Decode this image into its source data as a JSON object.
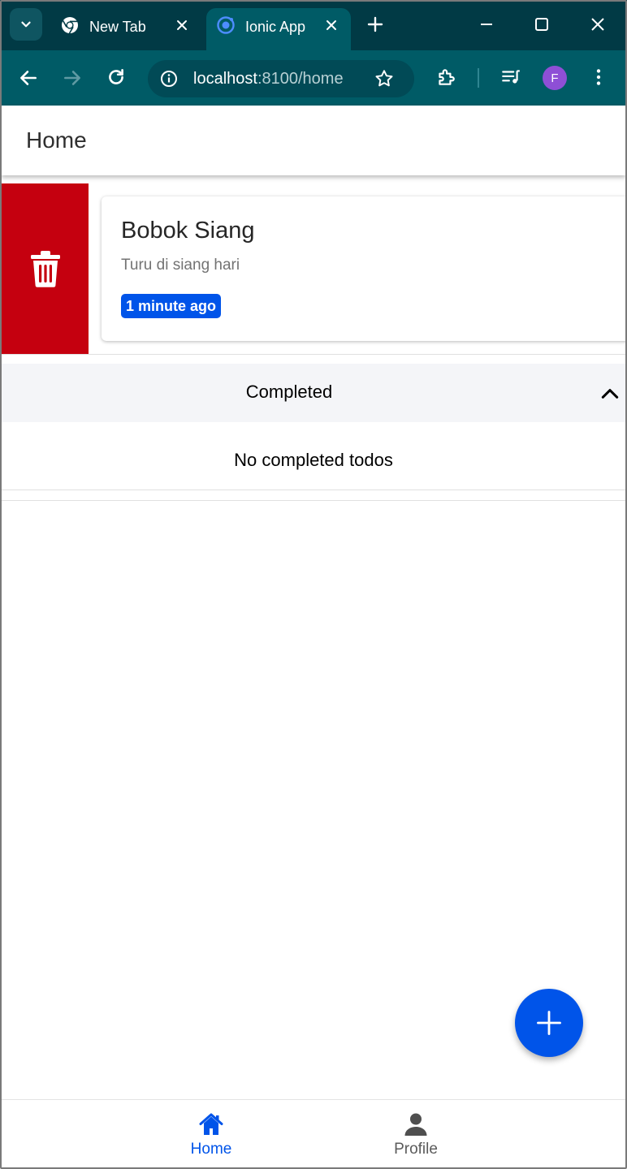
{
  "browser": {
    "tabs": [
      {
        "title": "New Tab",
        "active": false
      },
      {
        "title": "Ionic App",
        "active": true
      }
    ],
    "url_host": "localhost",
    "url_rest": ":8100/home",
    "profile_initial": "F",
    "colors": {
      "tabstrip": "#013a45",
      "toolbar": "#005b66",
      "omnibox": "#014a56",
      "avatar": "#8e4fd6"
    }
  },
  "header": {
    "title": "Home"
  },
  "todo": {
    "title": "Bobok Siang",
    "description": "Turu di siang hari",
    "time_badge": "1 minute ago",
    "delete_icon": "trash-icon"
  },
  "completed": {
    "label": "Completed",
    "expanded": true,
    "empty_text": "No completed todos"
  },
  "fab": {
    "icon": "plus-icon"
  },
  "tabbar": {
    "items": [
      {
        "label": "Home",
        "icon": "home-icon",
        "selected": true
      },
      {
        "label": "Profile",
        "icon": "person-icon",
        "selected": false
      }
    ]
  },
  "colors": {
    "primary": "#0054e9",
    "danger": "#c5000f",
    "accordion_bg": "#f4f5f8"
  }
}
